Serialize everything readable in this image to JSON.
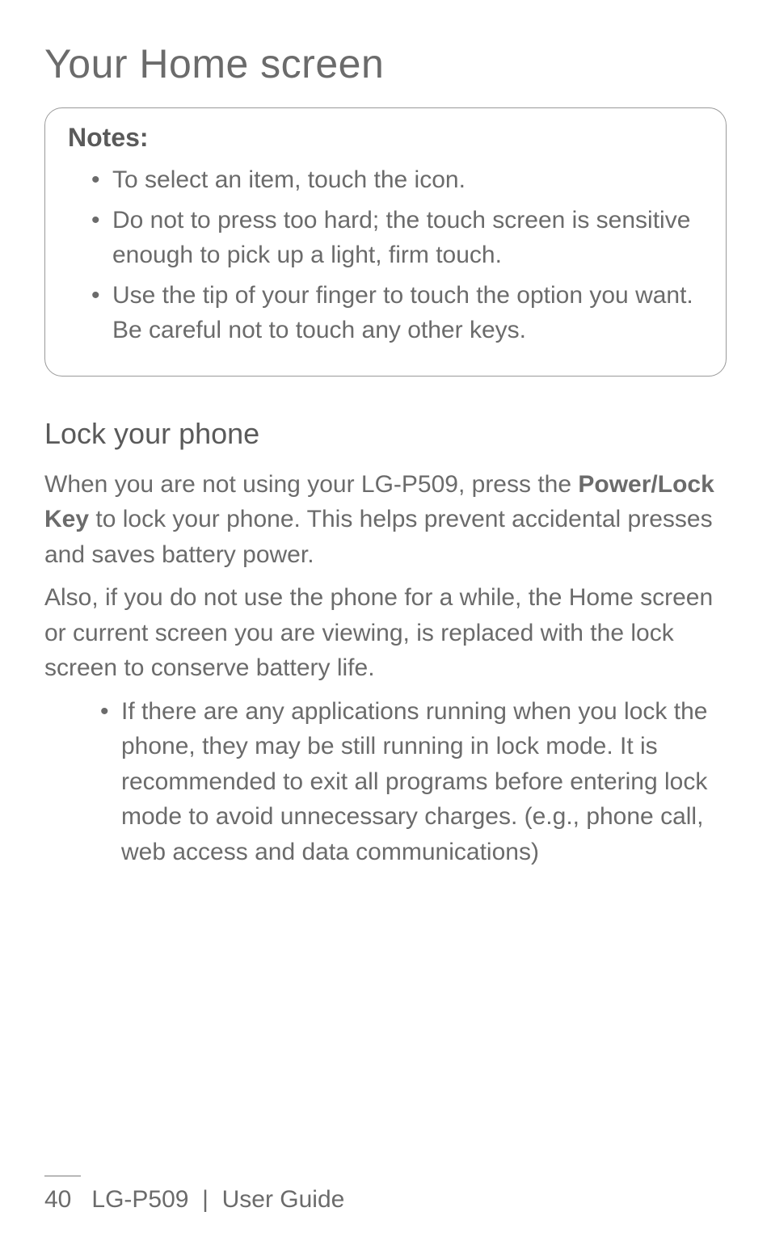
{
  "title": "Your Home screen",
  "notes": {
    "heading": "Notes:",
    "items": [
      "To select an item, touch the icon.",
      "Do not to press too hard; the touch screen is sensitive enough to pick up a light, firm touch.",
      "Use the tip of your finger to touch the option you want. Be careful not to touch any other keys."
    ]
  },
  "section": {
    "heading": "Lock your phone",
    "p1_pre": "When you are not using your LG-P509, press the ",
    "p1_bold": "Power/Lock Key",
    "p1_post": " to lock your phone. This helps prevent accidental presses and saves battery power.",
    "p2": "Also, if you do not use the phone for a while, the Home screen or current screen you are viewing, is replaced with the lock screen to conserve battery life.",
    "bullet": "If there are any applications running when you lock the phone, they may be still running in lock mode. It is recommended to exit all programs before entering lock mode to avoid unnecessary charges. (e.g., phone call, web access and data communications)"
  },
  "footer": {
    "page": "40",
    "spacer": "   ",
    "model": "LG-P509",
    "sep": "  |  ",
    "label": "User Guide"
  }
}
